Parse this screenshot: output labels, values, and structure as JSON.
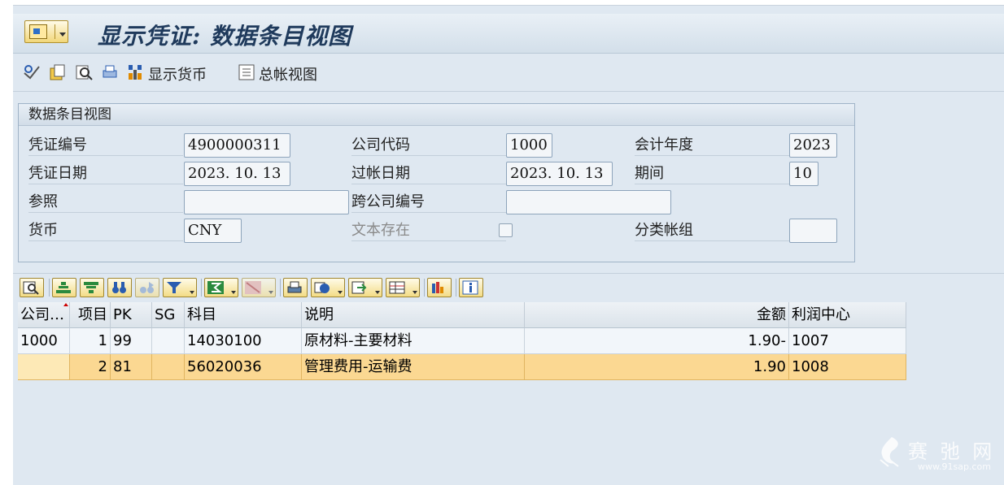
{
  "title": "显示凭证: 数据条目视图",
  "toolbar": {
    "display_currency": "显示货币",
    "gl_view": "总帐视图"
  },
  "panel": {
    "title": "数据条目视图",
    "doc_number_label": "凭证编号",
    "doc_number": "4900000311",
    "company_code_label": "公司代码",
    "company_code": "1000",
    "fiscal_year_label": "会计年度",
    "fiscal_year": "2023",
    "doc_date_label": "凭证日期",
    "doc_date": "2023. 10. 13",
    "posting_date_label": "过帐日期",
    "posting_date": "2023. 10. 13",
    "period_label": "期间",
    "period": "10",
    "reference_label": "参照",
    "reference": "",
    "cross_cc_label": "跨公司编号",
    "cross_cc": "",
    "currency_label": "货币",
    "currency": "CNY",
    "text_exists_label": "文本存在",
    "ledger_group_label": "分类帐组",
    "ledger_group": ""
  },
  "grid": {
    "headers": [
      "公司…",
      "项目",
      "PK",
      "SG",
      "科目",
      "说明",
      "金额",
      "利润中心"
    ],
    "rows": [
      {
        "company": "1000",
        "item": "1",
        "pk": "99",
        "sg": "",
        "account": "14030100",
        "desc": "原材料-主要材料",
        "amount": "1.90-",
        "profit_center": "1007"
      },
      {
        "company": "",
        "item": "2",
        "pk": "81",
        "sg": "",
        "account": "56020036",
        "desc": "管理费用-运输费",
        "amount": "1.90",
        "profit_center": "1008"
      }
    ]
  },
  "watermark": {
    "text": "赛 弛 网",
    "url": "www.91sap.com"
  },
  "colors": {
    "background": "#dfe8f1",
    "title": "#1f3a5c",
    "selected_row": "#fbd892",
    "button": "#f3dc86"
  }
}
